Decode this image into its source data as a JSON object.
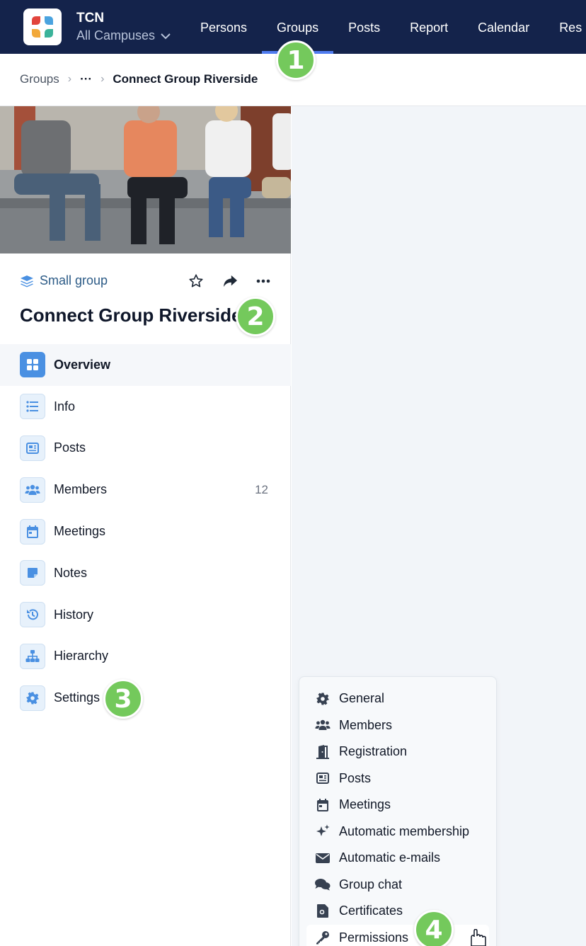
{
  "org": {
    "name": "TCN",
    "campus": "All Campuses"
  },
  "nav": [
    {
      "label": "Persons"
    },
    {
      "label": "Groups",
      "active": true
    },
    {
      "label": "Posts"
    },
    {
      "label": "Report"
    },
    {
      "label": "Calendar"
    },
    {
      "label": "Res"
    }
  ],
  "breadcrumb": {
    "root": "Groups",
    "ellipsis": "···",
    "current": "Connect Group Riverside"
  },
  "group": {
    "type": "Small group",
    "title": "Connect Group Riverside"
  },
  "menu": [
    {
      "label": "Overview",
      "icon": "grid-icon",
      "active": true
    },
    {
      "label": "Info",
      "icon": "list-icon"
    },
    {
      "label": "Posts",
      "icon": "newspaper-icon"
    },
    {
      "label": "Members",
      "icon": "users-icon",
      "count": "12"
    },
    {
      "label": "Meetings",
      "icon": "calendar-icon"
    },
    {
      "label": "Notes",
      "icon": "note-icon"
    },
    {
      "label": "History",
      "icon": "history-icon"
    },
    {
      "label": "Hierarchy",
      "icon": "sitemap-icon"
    },
    {
      "label": "Settings",
      "icon": "gear-icon"
    }
  ],
  "settings_menu": [
    {
      "label": "General",
      "icon": "gear-icon"
    },
    {
      "label": "Members",
      "icon": "users-icon"
    },
    {
      "label": "Registration",
      "icon": "door-icon"
    },
    {
      "label": "Posts",
      "icon": "newspaper-icon"
    },
    {
      "label": "Meetings",
      "icon": "calendar-icon"
    },
    {
      "label": "Automatic membership",
      "icon": "sparkles-icon"
    },
    {
      "label": "Automatic e-mails",
      "icon": "envelope-icon"
    },
    {
      "label": "Group chat",
      "icon": "comments-icon"
    },
    {
      "label": "Certificates",
      "icon": "certificate-icon"
    },
    {
      "label": "Permissions",
      "icon": "key-icon",
      "hover": true
    }
  ],
  "callouts": [
    "1",
    "2",
    "3",
    "4"
  ],
  "colors": {
    "topbar": "#14234b",
    "accent": "#4f7cf0",
    "badge": "#74c95c",
    "group_type": "#2b5a86"
  }
}
